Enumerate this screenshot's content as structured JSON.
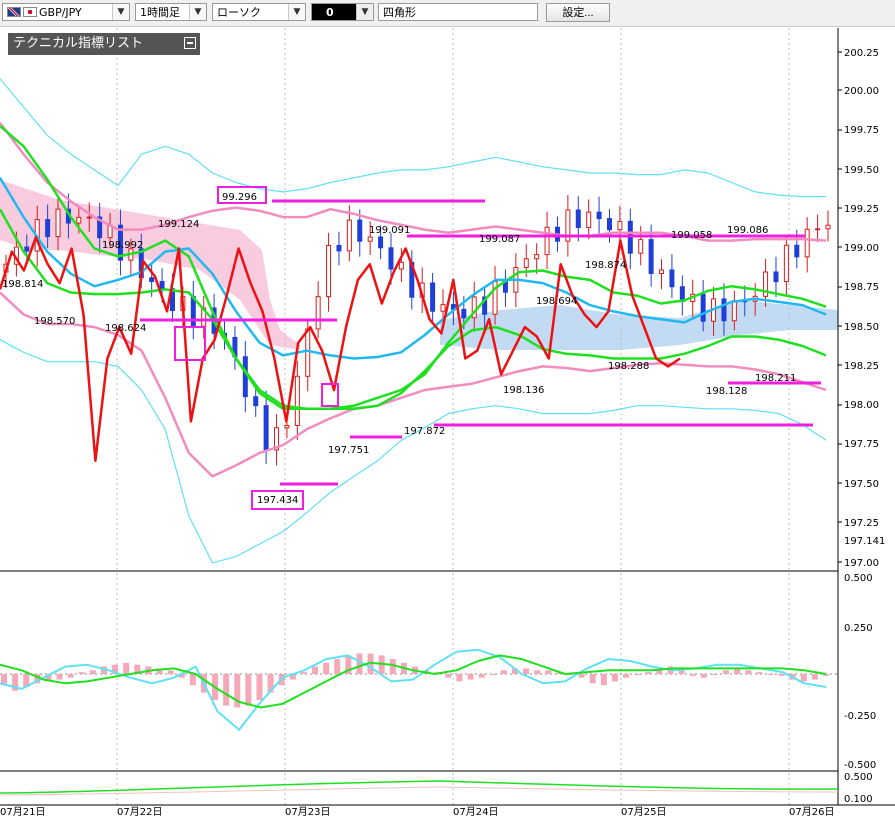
{
  "toolbar": {
    "symbol": "GBP/JPY",
    "timeframe": "1時間足",
    "chart_style": "ローソク",
    "color": "0",
    "shape": "四角形",
    "settings_label": "設定..."
  },
  "indicator_tab": {
    "label": "テクニカル指標リスト"
  },
  "colors": {
    "bull_candle": "#d81b1b",
    "bear_candle": "#1f3fd8",
    "bollinger_outer": "#5fe0f5",
    "bollinger_inner": "#f08cc0",
    "ma_green": "#1fe01f",
    "ma_cyan": "#20b8f0",
    "rci_red": "#ee1111",
    "cloud_blue": "#bcd6f2",
    "cloud_pink": "#f7c5dc",
    "annotation_magenta": "#f01ee0",
    "macd_hist": "#f4a8b8"
  },
  "chart_data": [
    {
      "type": "candlestick",
      "title": "",
      "ylim": [
        197.0,
        200.3
      ],
      "y_ticks": [
        "200.25",
        "200.00",
        "199.75",
        "199.50",
        "199.25",
        "199.00",
        "198.75",
        "198.50",
        "198.25",
        "198.00",
        "197.75",
        "197.50",
        "197.25",
        "197.141",
        "197.00"
      ],
      "x_ticks": [
        "07月21日",
        "07月22日",
        "07月23日",
        "07月24日",
        "07月25日",
        "07月26日"
      ],
      "price_labels": [
        "198.814",
        "198.570",
        "198.992",
        "198.624",
        "199.124",
        "99.296",
        "197.434",
        "197.751",
        "199.091",
        "197.872",
        "199.087",
        "198.136",
        "198.694",
        "198.874",
        "198.288",
        "199.058",
        "199.086",
        "198.128",
        "198.211"
      ],
      "series": [
        {
          "name": "",
          "kind": "bollinger_upper_2",
          "values": [
            200.08,
            199.9,
            199.72,
            199.6,
            199.5,
            199.4,
            199.6,
            199.65,
            199.6,
            199.48,
            199.42,
            199.38,
            199.36,
            199.38,
            199.42,
            199.45,
            199.48,
            199.5,
            199.5,
            199.52,
            199.55,
            199.58,
            199.55,
            199.52,
            199.5,
            199.48,
            199.48,
            199.47,
            199.47,
            199.5,
            199.48,
            199.42,
            199.36,
            199.34,
            199.33,
            199.33
          ]
        },
        {
          "name": "",
          "kind": "bollinger_upper_1",
          "values": [
            199.8,
            199.6,
            199.42,
            199.3,
            199.2,
            199.12,
            199.12,
            199.15,
            199.2,
            199.24,
            199.26,
            199.24,
            199.2,
            199.2,
            199.25,
            199.22,
            199.18,
            199.15,
            199.12,
            199.1,
            199.12,
            199.14,
            199.12,
            199.1,
            199.08,
            199.08,
            199.1,
            199.1,
            199.1,
            199.08,
            199.05,
            199.05,
            199.06,
            199.06,
            199.06,
            199.05
          ]
        },
        {
          "name": "",
          "kind": "bollinger_lower_1",
          "values": [
            198.72,
            198.58,
            198.52,
            198.52,
            198.5,
            198.45,
            198.35,
            198.05,
            197.7,
            197.55,
            197.62,
            197.7,
            197.75,
            197.85,
            197.92,
            197.98,
            198.0,
            198.05,
            198.1,
            198.12,
            198.14,
            198.18,
            198.22,
            198.25,
            198.24,
            198.22,
            198.24,
            198.26,
            198.27,
            198.26,
            198.25,
            198.25,
            198.23,
            198.2,
            198.15,
            198.1
          ]
        },
        {
          "name": "",
          "kind": "bollinger_lower_2",
          "values": [
            198.42,
            198.34,
            198.28,
            198.28,
            198.28,
            198.25,
            198.1,
            197.85,
            197.3,
            197.0,
            197.04,
            197.12,
            197.2,
            197.32,
            197.45,
            197.55,
            197.65,
            197.78,
            197.86,
            197.95,
            197.98,
            198.0,
            197.98,
            197.95,
            197.95,
            197.95,
            197.97,
            198.0,
            198.0,
            197.99,
            197.98,
            197.98,
            197.97,
            197.95,
            197.88,
            197.78
          ]
        },
        {
          "name": "",
          "kind": "ma_long_green",
          "values": [
            199.78,
            199.65,
            199.44,
            199.2,
            199.0,
            198.95,
            198.98,
            199.05,
            198.95,
            198.6,
            198.3,
            198.1,
            198.0,
            197.98,
            197.98,
            198.0,
            198.05,
            198.1,
            198.2,
            198.4,
            198.58,
            198.75,
            198.85,
            198.86,
            198.82,
            198.8,
            198.72,
            198.7,
            198.65,
            198.67,
            198.73,
            198.76,
            198.74,
            198.71,
            198.68,
            198.63
          ]
        },
        {
          "name": "",
          "kind": "ma_short_green",
          "values": [
            199.25,
            198.98,
            198.78,
            198.72,
            198.71,
            198.71,
            198.72,
            198.74,
            198.72,
            198.55,
            198.3,
            198.08,
            197.98,
            197.98,
            197.98,
            197.98,
            198.0,
            198.08,
            198.22,
            198.38,
            198.48,
            198.5,
            198.45,
            198.36,
            198.33,
            198.32,
            198.3,
            198.3,
            198.3,
            198.33,
            198.38,
            198.44,
            198.44,
            198.42,
            198.38,
            198.32
          ]
        },
        {
          "name": "",
          "kind": "ma_cyan",
          "values": [
            199.45,
            199.2,
            198.98,
            198.84,
            198.76,
            198.8,
            198.85,
            198.98,
            199.0,
            198.84,
            198.6,
            198.4,
            198.32,
            198.35,
            198.32,
            198.3,
            198.31,
            198.34,
            198.45,
            198.58,
            198.7,
            198.8,
            198.8,
            198.78,
            198.72,
            198.64,
            198.6,
            198.57,
            198.55,
            198.53,
            198.6,
            198.66,
            198.68,
            198.66,
            198.64,
            198.58
          ]
        },
        {
          "name": "",
          "kind": "rci_red",
          "values": [
            198.74,
            198.98,
            198.86,
            199.07,
            198.9,
            198.78,
            199.0,
            198.58,
            197.65,
            198.3,
            198.5,
            198.33,
            198.92,
            198.82,
            198.6,
            199.0,
            197.9,
            198.3,
            198.42,
            198.7,
            199.0,
            198.78,
            198.6,
            198.3,
            197.9,
            198.4,
            198.5,
            198.35,
            198.1,
            198.5,
            198.8,
            198.9,
            198.65,
            198.85,
            199.0,
            198.8,
            198.55,
            198.46,
            198.8,
            198.3,
            198.35,
            198.55,
            198.2,
            198.35,
            198.5,
            198.44,
            198.3,
            198.9,
            198.7,
            198.58,
            198.5,
            198.6,
            199.05,
            198.7,
            198.5,
            198.3,
            198.25,
            198.3
          ]
        }
      ]
    },
    {
      "type": "bar",
      "title": "",
      "ylim": [
        -0.5,
        0.5
      ],
      "y_ticks": [
        "0.500",
        "0.250",
        "-0.250",
        "-0.500"
      ],
      "series": [
        {
          "name": "",
          "kind": "histogram",
          "values": [
            -0.06,
            -0.09,
            -0.07,
            -0.05,
            -0.04,
            -0.03,
            -0.02,
            0.01,
            0.02,
            0.04,
            0.05,
            0.06,
            0.05,
            0.04,
            0.03,
            0.02,
            -0.02,
            -0.06,
            -0.1,
            -0.14,
            -0.17,
            -0.18,
            -0.17,
            -0.14,
            -0.1,
            -0.06,
            -0.03,
            0.01,
            0.04,
            0.06,
            0.08,
            0.1,
            0.11,
            0.11,
            0.1,
            0.08,
            0.06,
            0.04,
            0.02,
            0.01,
            -0.02,
            -0.04,
            -0.03,
            -0.02,
            0.0,
            0.02,
            0.03,
            0.03,
            0.02,
            0.02,
            0.01,
            0.0,
            -0.02,
            -0.05,
            -0.06,
            -0.04,
            -0.02,
            0.0,
            0.01,
            0.03,
            0.04,
            0.02,
            -0.01,
            -0.02,
            0.0,
            0.02,
            0.03,
            0.02,
            0.01,
            0.0,
            -0.01,
            -0.03,
            -0.04,
            -0.03,
            -0.01
          ]
        },
        {
          "name": "",
          "kind": "macd_cyan",
          "values": [
            -0.05,
            -0.08,
            -0.02,
            0.04,
            0.05,
            0.02,
            -0.02,
            -0.05,
            -0.02,
            0.04,
            -0.2,
            -0.3,
            -0.15,
            -0.02,
            0.02,
            0.08,
            0.1,
            0.04,
            -0.04,
            -0.03,
            0.05,
            0.12,
            0.13,
            0.09,
            0.0,
            -0.05,
            -0.04,
            0.03,
            0.08,
            0.07,
            0.04,
            0.02,
            0.03,
            0.05,
            0.05,
            0.03,
            0.01,
            -0.05,
            -0.07
          ]
        },
        {
          "name": "",
          "kind": "signal_green",
          "values": [
            0.05,
            0.02,
            -0.03,
            -0.05,
            -0.04,
            -0.02,
            0.0,
            0.02,
            0.03,
            0.0,
            -0.08,
            -0.15,
            -0.18,
            -0.16,
            -0.1,
            -0.04,
            0.02,
            0.06,
            0.05,
            0.02,
            0.0,
            0.02,
            0.07,
            0.1,
            0.08,
            0.04,
            0.0,
            0.01,
            0.02,
            0.02,
            0.02,
            0.03,
            0.03,
            0.03,
            0.03,
            0.03,
            0.03,
            0.02,
            0.0
          ]
        }
      ]
    },
    {
      "type": "line",
      "title": "",
      "ylim": [
        0.1,
        0.5
      ],
      "y_ticks": [
        "0.500",
        "0.100"
      ]
    }
  ]
}
